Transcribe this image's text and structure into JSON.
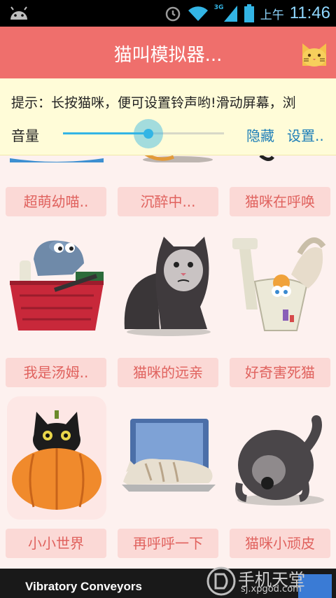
{
  "status_bar": {
    "icons": [
      "android-icon",
      "alarm-icon",
      "wifi-icon",
      "signal-icon",
      "battery-icon"
    ],
    "network_label": "3G",
    "ampm": "上午",
    "time": "11:46"
  },
  "header": {
    "title": "猫叫模拟器...",
    "icon": "cat-face-icon"
  },
  "hint_panel": {
    "hint": "提示：长按猫咪，便可设置铃声哟!滑动屏幕，浏",
    "volume_label": "音量",
    "volume_level": 0.53,
    "hide_label": "隐藏",
    "settings_label": "设置.."
  },
  "cats": [
    {
      "label": "超萌幼喵..",
      "icon": "kitten-icon"
    },
    {
      "label": "沉醉中...",
      "icon": "drunk-cat-icon"
    },
    {
      "label": "猫咪在呼唤",
      "icon": "calling-cat-icon"
    },
    {
      "label": "我是汤姆..",
      "icon": "cat-in-basket-icon"
    },
    {
      "label": "猫咪的远亲",
      "icon": "grumpy-cat-icon"
    },
    {
      "label": "好奇害死猫",
      "icon": "cat-in-toilet-icon"
    },
    {
      "label": "小小世界",
      "icon": "cat-in-pumpkin-icon"
    },
    {
      "label": "再呼呼一下",
      "icon": "cat-on-laptop-icon"
    },
    {
      "label": "猫咪小顽皮",
      "icon": "cat-behind-icon"
    }
  ],
  "ad": {
    "text": "Vibratory Conveyors"
  },
  "watermark": {
    "title": "手机天堂",
    "url": "sj.xpgod.com"
  },
  "colors": {
    "title_bar": "#ef6f6c",
    "label_bg": "#fbd9d6",
    "label_text": "#e0625e",
    "accent": "#33b5e5",
    "hint_bg": "#fffcd8",
    "link": "#1f7fb8"
  }
}
